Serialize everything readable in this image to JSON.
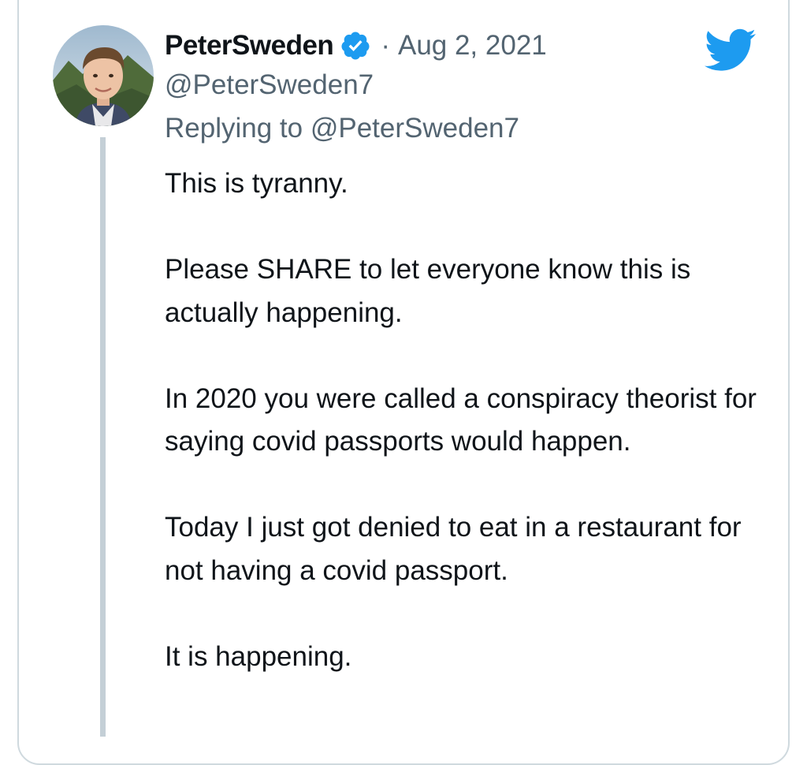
{
  "tweet": {
    "author_name": "PeterSweden",
    "separator": "·",
    "date": "Aug 2, 2021",
    "handle": "@PeterSweden7",
    "replying_to": "Replying to @PeterSweden7",
    "paragraphs": [
      "This is tyranny.",
      "Please SHARE to let everyone know this is actually happening.",
      "In 2020 you were called a conspiracy theorist for saying covid passports would happen.",
      "Today I just got denied to eat in a restaurant for not having a covid passport.",
      "It is happening."
    ]
  },
  "icons": {
    "verified": "verified-badge-icon",
    "brand": "twitter-bird-icon",
    "avatar": "profile-photo"
  },
  "colors": {
    "text_primary": "#0f1419",
    "text_secondary": "#536471",
    "brand_blue": "#1d9bf0",
    "thread_line": "#c4cfd6",
    "card_border": "#cfd9de"
  }
}
